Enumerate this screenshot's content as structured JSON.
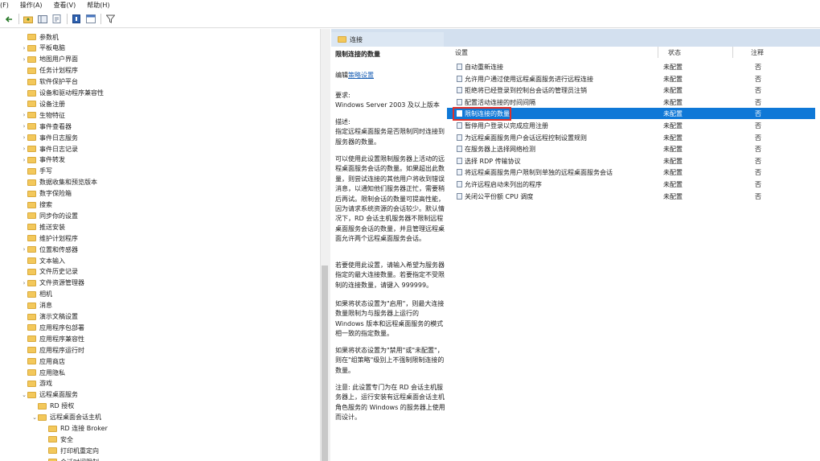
{
  "menu": [
    "(F)",
    "操作(A)",
    "查看(V)",
    "帮助(H)"
  ],
  "toolbar_icons": [
    "back-icon",
    "forward-icon",
    "up-folder-icon",
    "show-hide-tree-icon",
    "export-list-icon",
    "help-icon",
    "properties-icon",
    "filter-icon"
  ],
  "tree": [
    {
      "label": "参数机",
      "indent": 0,
      "exp": ""
    },
    {
      "label": "平板电脑",
      "indent": 0,
      "exp": ">"
    },
    {
      "label": "地图用户界面",
      "indent": 0,
      "exp": ">"
    },
    {
      "label": "任务计划程序",
      "indent": 0,
      "exp": ""
    },
    {
      "label": "软件保护平台",
      "indent": 0,
      "exp": ""
    },
    {
      "label": "设备和驱动程序兼容性",
      "indent": 0,
      "exp": ""
    },
    {
      "label": "设备注册",
      "indent": 0,
      "exp": ""
    },
    {
      "label": "生物特征",
      "indent": 0,
      "exp": ">"
    },
    {
      "label": "事件查看器",
      "indent": 0,
      "exp": ">"
    },
    {
      "label": "事件日志服务",
      "indent": 0,
      "exp": ">"
    },
    {
      "label": "事件日志记录",
      "indent": 0,
      "exp": ">"
    },
    {
      "label": "事件转发",
      "indent": 0,
      "exp": ">"
    },
    {
      "label": "手写",
      "indent": 0,
      "exp": ""
    },
    {
      "label": "数据收集和预览版本",
      "indent": 0,
      "exp": ""
    },
    {
      "label": "数字保险箱",
      "indent": 0,
      "exp": ""
    },
    {
      "label": "搜索",
      "indent": 0,
      "exp": ""
    },
    {
      "label": "同步你的设置",
      "indent": 0,
      "exp": ""
    },
    {
      "label": "推送安装",
      "indent": 0,
      "exp": ""
    },
    {
      "label": "维护计划程序",
      "indent": 0,
      "exp": ""
    },
    {
      "label": "位置和传感器",
      "indent": 0,
      "exp": ">"
    },
    {
      "label": "文本输入",
      "indent": 0,
      "exp": ""
    },
    {
      "label": "文件历史记录",
      "indent": 0,
      "exp": ""
    },
    {
      "label": "文件资源管理器",
      "indent": 0,
      "exp": ">"
    },
    {
      "label": "相机",
      "indent": 0,
      "exp": ""
    },
    {
      "label": "消息",
      "indent": 0,
      "exp": ""
    },
    {
      "label": "演示文稿设置",
      "indent": 0,
      "exp": ""
    },
    {
      "label": "应用程序包部署",
      "indent": 0,
      "exp": ""
    },
    {
      "label": "应用程序兼容性",
      "indent": 0,
      "exp": ""
    },
    {
      "label": "应用程序运行时",
      "indent": 0,
      "exp": ""
    },
    {
      "label": "应用商店",
      "indent": 0,
      "exp": ""
    },
    {
      "label": "应用隐私",
      "indent": 0,
      "exp": ""
    },
    {
      "label": "游戏",
      "indent": 0,
      "exp": ""
    },
    {
      "label": "远程桌面服务",
      "indent": 0,
      "exp": "v"
    },
    {
      "label": "RD 授权",
      "indent": 1,
      "exp": ""
    },
    {
      "label": "远程桌面会话主机",
      "indent": 1,
      "exp": "v"
    },
    {
      "label": "RD 连接 Broker",
      "indent": 2,
      "exp": ""
    },
    {
      "label": "安全",
      "indent": 2,
      "exp": ""
    },
    {
      "label": "打印机重定向",
      "indent": 2,
      "exp": ""
    },
    {
      "label": "会话时间限制",
      "indent": 2,
      "exp": ""
    }
  ],
  "header": {
    "tab_label": "连接"
  },
  "description": {
    "title": "限制连接的数量",
    "edit_prefix": "编辑",
    "edit_link": "策略设置",
    "requirement_label": "要求:",
    "requirement_value": "Windows Server 2003 及以上版本",
    "paragraphs": [
      "描述:\n指定远程桌面服务是否限制同时连接到服务器的数量。",
      "可以使用此设置限制服务器上活动的远程桌面服务会话的数量。如果超出此数量，则尝试连接的其他用户将收到错误消息，以通知他们服务器正忙，需要稍后再试。限制会话的数量可提高性能，因为请求系统资源的会话较少。默认情况下，RD 会话主机服务器不限制远程桌面服务会话的数量，并且管理远程桌面允许两个远程桌面服务会话。",
      "若要使用此设置，请输入希望为服务器指定的最大连接数量。若要指定不受限制的连接数量，请键入 999999。",
      "如果将状态设置为\"启用\"，则最大连接数量限制为与服务器上运行的 Windows 版本和远程桌面服务的模式相一致的指定数量。",
      "如果将状态设置为\"禁用\"或\"未配置\"，则在\"组策略\"级别上不强制限制连接的数量。",
      "注意: 此设置专门为在 RD 会话主机服务器上，运行安装有远程桌面会话主机角色服务的 Windows 的服务器上使用而设计。"
    ]
  },
  "list": {
    "columns": [
      "设置",
      "状态",
      "注释"
    ],
    "rows": [
      {
        "name": "自动重新连接",
        "state": "未配置",
        "note": "否"
      },
      {
        "name": "允许用户通过使用远程桌面服务进行远程连接",
        "state": "未配置",
        "note": "否"
      },
      {
        "name": "拒绝将已经登录到控制台会话的管理员注销",
        "state": "未配置",
        "note": "否"
      },
      {
        "name": "配置活动连接的时间间隔",
        "state": "未配置",
        "note": "否"
      },
      {
        "name": "限制连接的数量",
        "state": "未配置",
        "note": "否"
      },
      {
        "name": "暂停用户登录以完成应用注册",
        "state": "未配置",
        "note": "否"
      },
      {
        "name": "为远程桌面服务用户会话远程控制设置规则",
        "state": "未配置",
        "note": "否"
      },
      {
        "name": "在服务器上选择网络检测",
        "state": "未配置",
        "note": "否"
      },
      {
        "name": "选择 RDP 传输协议",
        "state": "未配置",
        "note": "否"
      },
      {
        "name": "将远程桌面服务用户限制到单独的远程桌面服务会话",
        "state": "未配置",
        "note": "否"
      },
      {
        "name": "允许远程启动未列出的程序",
        "state": "未配置",
        "note": "否"
      },
      {
        "name": "关闭公平份额 CPU 调度",
        "state": "未配置",
        "note": "否"
      }
    ],
    "selected_index": 4
  },
  "colors": {
    "selection": "#0f78d7",
    "highlight_box": "#e0302a",
    "header_strip": "#d3e0ef",
    "folder": "#f3c85b"
  }
}
